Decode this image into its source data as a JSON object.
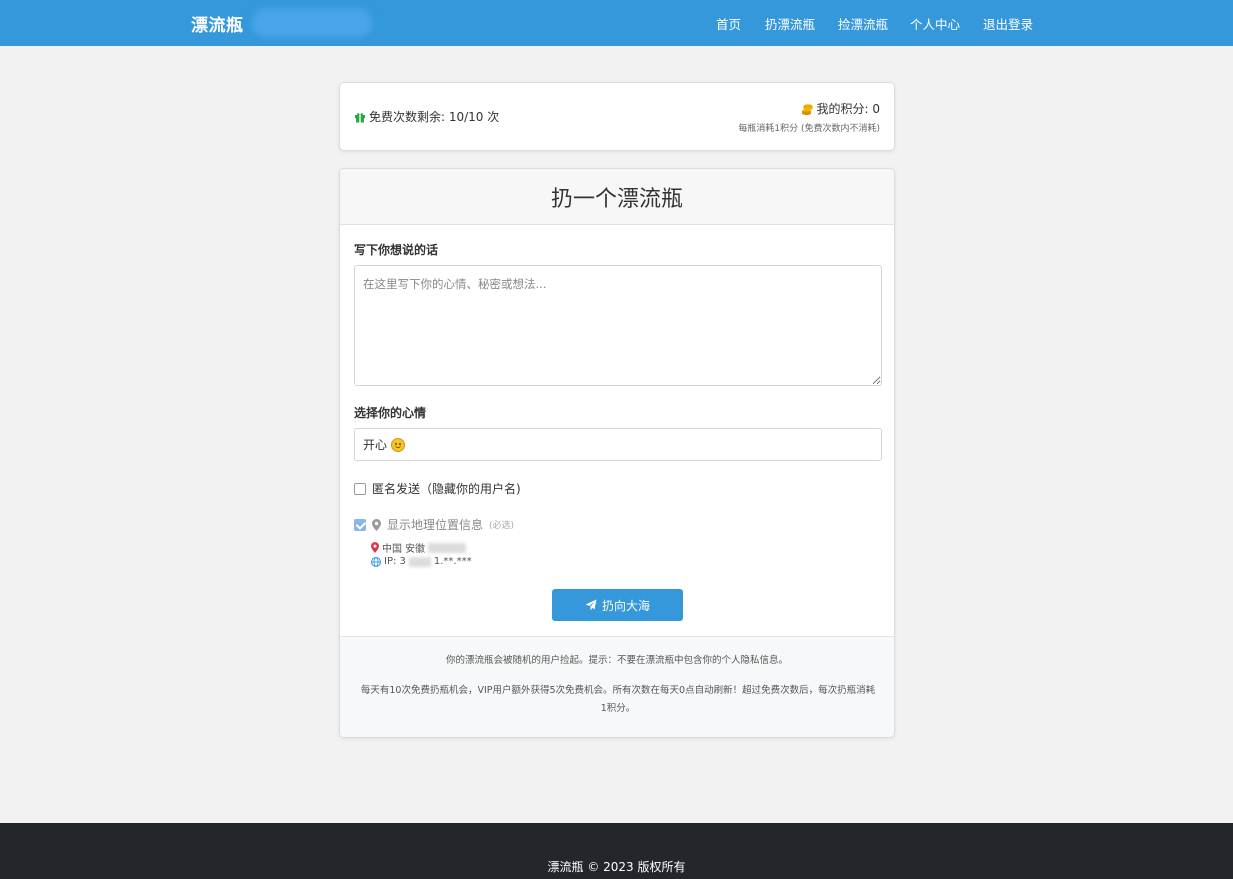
{
  "nav": {
    "brand": "漂流瓶",
    "links": [
      "首页",
      "扔漂流瓶",
      "捡漂流瓶",
      "个人中心",
      "退出登录"
    ]
  },
  "quota": {
    "free_text": "免费次数剩余: 10/10 次",
    "points_text": "我的积分: 0",
    "points_note": "每瓶消耗1积分 (免费次数内不消耗)"
  },
  "form": {
    "title": "扔一个漂流瓶",
    "message_label": "写下你想说的话",
    "message_placeholder": "在这里写下你的心情、秘密或想法...",
    "mood_label": "选择你的心情",
    "mood_value": "开心",
    "anonymous_label": "匿名发送（隐藏你的用户名)",
    "location_label": "显示地理位置信息",
    "location_hint": "(必选)",
    "location_region": "中国 安徽",
    "ip_prefix": "IP: 3",
    "ip_suffix": "1.**.***",
    "submit_label": "扔向大海"
  },
  "notes": {
    "privacy": "你的漂流瓶会被随机的用户捡起。提示：不要在漂流瓶中包含你的个人隐私信息。",
    "rules": "每天有10次免费扔瓶机会，VIP用户额外获得5次免费机会。所有次数在每天0点自动刷新！超过免费次数后，每次扔瓶消耗1积分。"
  },
  "footer": {
    "copyright": "漂流瓶 © 2023 版权所有"
  },
  "colors": {
    "primary": "#3498db",
    "footer_bg": "#23272b",
    "page_bg": "#f2f2f2",
    "gift_icon": "#28a745",
    "coins_icon": "#f0b400",
    "location_pin": "#dc3545",
    "globe_icon": "#3498db"
  },
  "icons": {
    "gift": "gift-icon",
    "coins": "coins-icon",
    "map_marker": "map-marker-icon",
    "globe": "globe-icon",
    "paper_plane": "paper-plane-icon"
  }
}
